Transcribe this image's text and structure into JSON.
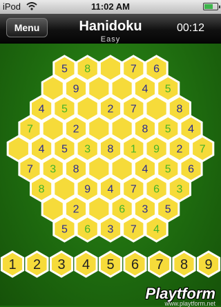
{
  "status": {
    "carrier": "iPod",
    "time": "11:02 AM"
  },
  "header": {
    "menu_label": "Menu",
    "title": "Hanidoku",
    "difficulty": "Easy",
    "timer": "00:12"
  },
  "colors": {
    "given": "#2b2b8f",
    "entered": "#43b22a",
    "cell": "#f6db3a",
    "cell_border": "#ffffff",
    "board_dark": "#1e6a0e"
  },
  "board": {
    "rows": [
      [
        "5",
        "8",
        "",
        "7",
        "6"
      ],
      [
        "",
        "9",
        "",
        "",
        "4",
        "5"
      ],
      [
        "4",
        "5",
        "",
        "2",
        "7",
        "",
        "8"
      ],
      [
        "7",
        "",
        "2",
        "",
        "",
        "8",
        "5",
        "4"
      ],
      [
        "",
        "4",
        "5",
        "3",
        "8",
        "1",
        "9",
        "2",
        "7"
      ],
      [
        "7",
        "3",
        "8",
        "",
        "",
        "4",
        "5",
        "6"
      ],
      [
        "8",
        "",
        "9",
        "4",
        "7",
        "6",
        "3"
      ],
      [
        "",
        "2",
        "",
        "6",
        "3",
        "5"
      ],
      [
        "5",
        "6",
        "3",
        "7",
        "4"
      ]
    ],
    "kinds": [
      [
        "g",
        "e",
        "",
        "g",
        "g"
      ],
      [
        "",
        "g",
        "",
        "",
        "g",
        "e"
      ],
      [
        "g",
        "e",
        "",
        "g",
        "g",
        "",
        "g"
      ],
      [
        "e",
        "",
        "g",
        "",
        "",
        "g",
        "e",
        "g"
      ],
      [
        "",
        "g",
        "g",
        "e",
        "g",
        "e",
        "e",
        "g",
        "e"
      ],
      [
        "g",
        "e",
        "g",
        "",
        "",
        "g",
        "e",
        "g"
      ],
      [
        "e",
        "",
        "g",
        "g",
        "g",
        "e",
        "e"
      ],
      [
        "",
        "g",
        "",
        "e",
        "g",
        "g"
      ],
      [
        "g",
        "e",
        "g",
        "g",
        "e"
      ]
    ]
  },
  "keypad": [
    "1",
    "2",
    "3",
    "4",
    "5",
    "6",
    "7",
    "8",
    "9"
  ],
  "watermark": {
    "brand": "Playtform",
    "url": "www.playtform.net"
  }
}
